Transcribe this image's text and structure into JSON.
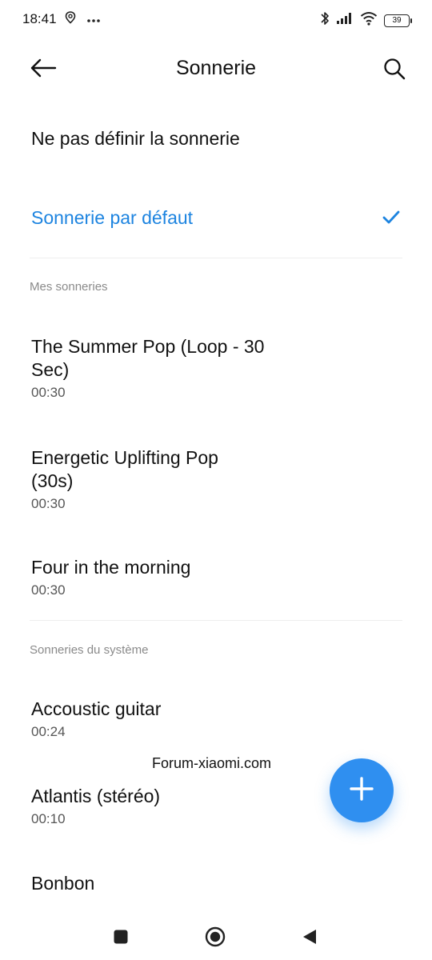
{
  "status_bar": {
    "time": "18:41",
    "battery": "39",
    "icons": [
      "location-icon",
      "more-dots-icon",
      "bluetooth-icon",
      "signal-icon",
      "wifi-icon",
      "battery-icon"
    ]
  },
  "header": {
    "title": "Sonnerie",
    "back_icon": "back-arrow-icon",
    "search_icon": "search-icon"
  },
  "options": {
    "none_label": "Ne pas définir la sonnerie",
    "default_label": "Sonnerie par défaut",
    "selected_icon": "check-icon"
  },
  "my_ringtones": {
    "header": "Mes sonneries",
    "items": [
      {
        "title_line1": "The Summer Pop (Loop - 30",
        "title_line2": "Sec)",
        "duration": "00:30"
      },
      {
        "title_line1": "Energetic Uplifting Pop",
        "title_line2": "(30s)",
        "duration": "00:30"
      },
      {
        "title_line1": "Four in the morning",
        "duration": "00:30"
      }
    ]
  },
  "system_ringtones": {
    "header": "Sonneries du système",
    "items": [
      {
        "title": "Accoustic guitar",
        "duration": "00:24"
      },
      {
        "title": "Atlantis (stéréo)",
        "duration": "00:10"
      },
      {
        "title": "Bonbon"
      }
    ]
  },
  "watermark": "Forum-xiaomi.com",
  "fab": {
    "icon": "plus-icon"
  },
  "colors": {
    "accent": "#1d84e0",
    "fab": "#2f8ff0",
    "section_header": "#8a8a8a"
  },
  "nav": {
    "icons": [
      "recents-square-icon",
      "home-circle-icon",
      "back-triangle-icon"
    ]
  }
}
